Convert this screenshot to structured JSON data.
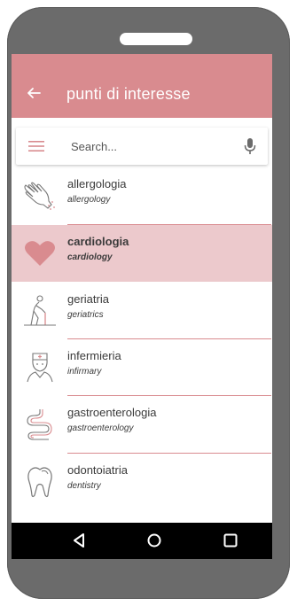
{
  "appbar": {
    "title": "punti di interesse"
  },
  "search": {
    "placeholder": "Search..."
  },
  "items": [
    {
      "label": "allergologia",
      "sub": "allergology",
      "icon": "hand-icon"
    },
    {
      "label": "cardiologia",
      "sub": "cardiology",
      "icon": "heart-icon",
      "selected": true
    },
    {
      "label": "geriatria",
      "sub": "geriatrics",
      "icon": "elderly-person-icon"
    },
    {
      "label": "infermieria",
      "sub": "infirmary",
      "icon": "nurse-icon"
    },
    {
      "label": "gastroenterologia",
      "sub": "gastroenterology",
      "icon": "intestine-icon"
    },
    {
      "label": "odontoiatria",
      "sub": "dentistry",
      "icon": "tooth-icon"
    }
  ],
  "colors": {
    "accent": "#d98b8f",
    "selected_bg": "#ecc9cc",
    "device": "#6b6b6b"
  }
}
